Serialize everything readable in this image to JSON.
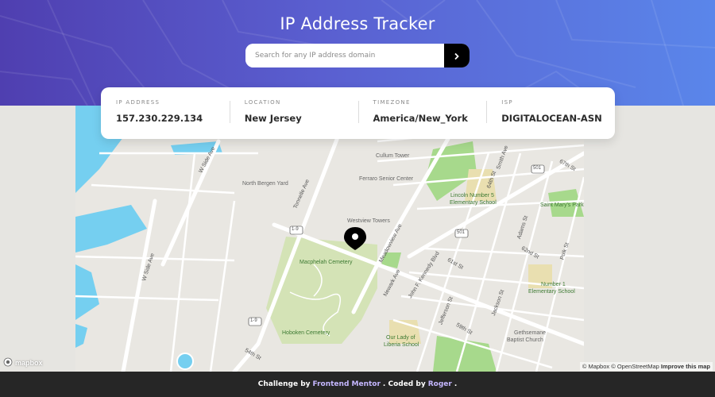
{
  "header": {
    "title": "IP Address Tracker",
    "search_placeholder": "Search for any IP address domain",
    "search_button_icon": "chevron-right-icon"
  },
  "info": {
    "ip_label": "IP ADDRESS",
    "ip_value": "157.230.229.134",
    "location_label": "LOCATION",
    "location_value": "New Jersey",
    "timezone_label": "TIMEZONE",
    "timezone_value": "America/New_York",
    "isp_label": "ISP",
    "isp_value": "DIGITALOCEAN-ASN"
  },
  "map": {
    "labels": {
      "cullum": "Cullum Tower",
      "ferraro": "Ferraro Senior Center",
      "north_bergen": "North Bergen Yard",
      "westview": "Westview Towers",
      "macphelah": "Macphelah Cemetery",
      "hoboken": "Hoboken Cemetery",
      "lincoln": "Lincoln Number 5",
      "lincoln2": "Elementary School",
      "st_marys": "Saint Mary's Park",
      "number1": "Number 1",
      "number1b": "Elementary School",
      "our_lady": "Our Lady of",
      "our_lady2": "Liberia School",
      "gethsemane": "Gethsemane",
      "gethsemane2": "Baptist Church"
    },
    "streets": {
      "w_side_ave_top": "W Side Ave",
      "w_side_ave_bottom": "W Side Ave",
      "tonnelle": "Tonnelle Ave",
      "meadowview": "Meadowview Ave",
      "newark": "Newark Ave",
      "jfk": "John F. Kennedy Blvd",
      "jefferson": "Jefferson St",
      "jackson": "Jackson St",
      "adams": "Adams St",
      "polk": "Polk St",
      "smith": "Smith Ave",
      "s64": "64th St",
      "s67": "67th St",
      "s62": "62nd St",
      "s61": "61st St",
      "s59": "59th St",
      "s54": "54th St",
      "route_1_9": "1-9",
      "route_501": "501",
      "route_501b": "501",
      "route_1_9b": "1-9",
      "route_501c": "501"
    },
    "logo": "mapbox",
    "attribution_mapbox": "© Mapbox",
    "attribution_osm": "© OpenStreetMap",
    "attribution_improve": "Improve this map"
  },
  "footer": {
    "prefix": "Challenge by",
    "challenge_link": "Frontend Mentor",
    "middle": ". Coded by",
    "author_link": "Roger",
    "suffix": "."
  },
  "colors": {
    "header_start": "#4f3fb0",
    "header_end": "#5a86ea",
    "water": "#75cff0",
    "park": "#c8dfa6",
    "footer_bg": "#262626"
  }
}
